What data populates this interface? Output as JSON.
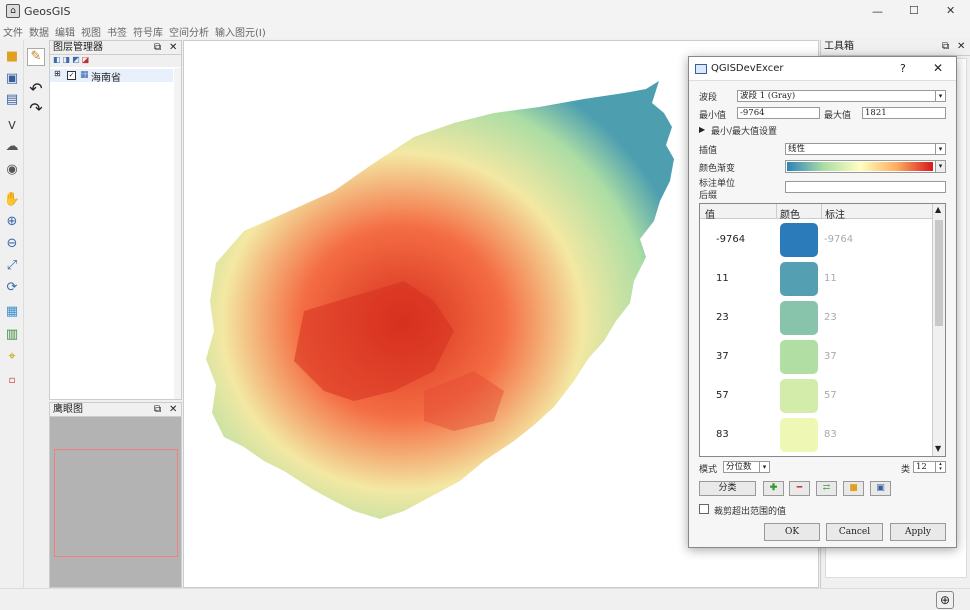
{
  "app": {
    "title": "GeosGIS",
    "window_controls": [
      "—",
      "☐",
      "✕"
    ]
  },
  "menu": [
    "文件",
    "数据",
    "编辑",
    "视图",
    "书签",
    "符号库",
    "空间分析",
    "输入图元(I)"
  ],
  "layer_panel": {
    "title": "图层管理器",
    "layer_name": "海南省"
  },
  "overview_panel": {
    "title": "鹰眼图"
  },
  "toolbox": {
    "title": "工具箱"
  },
  "dialog": {
    "title": "QGISDevExcer",
    "help": "?",
    "close": "✕",
    "band_label": "波段",
    "band_value": "波段 1 (Gray)",
    "min_label": "最小值",
    "min_value": "-9764",
    "max_label": "最大值",
    "max_value": "1821",
    "minmax_settings": "最小/最大值设置",
    "interp_label": "插值",
    "interp_value": "线性",
    "ramp_label": "颜色渐变",
    "unit_label_line1": "标注单位",
    "unit_label_line2": "后缀",
    "table": {
      "headers": [
        "值",
        "颜色",
        "标注"
      ],
      "rows": [
        {
          "value": "-9764",
          "color": "#2b7bba",
          "label": "-9764"
        },
        {
          "value": "11",
          "color": "#559fb2",
          "label": "11"
        },
        {
          "value": "23",
          "color": "#88c3ab",
          "label": "23"
        },
        {
          "value": "37",
          "color": "#b1dfa3",
          "label": "37"
        },
        {
          "value": "57",
          "color": "#d3ecaa",
          "label": "57"
        },
        {
          "value": "83",
          "color": "#eef8b4",
          "label": "83"
        }
      ]
    },
    "mode_label": "模式",
    "mode_value": "分位数",
    "classes_label": "类",
    "classes_value": "12",
    "classify_btn": "分类",
    "clip_label": "裁剪超出范围的值",
    "ok": "OK",
    "cancel": "Cancel",
    "apply": "Apply"
  },
  "colors": {
    "ramp": [
      "#2b83ba",
      "#abdda4",
      "#ffffbf",
      "#fdae61",
      "#d7191c"
    ],
    "island_coast": "#4d9fb0",
    "island_mid": "#f3e8a3",
    "island_high": "#d7301f"
  }
}
